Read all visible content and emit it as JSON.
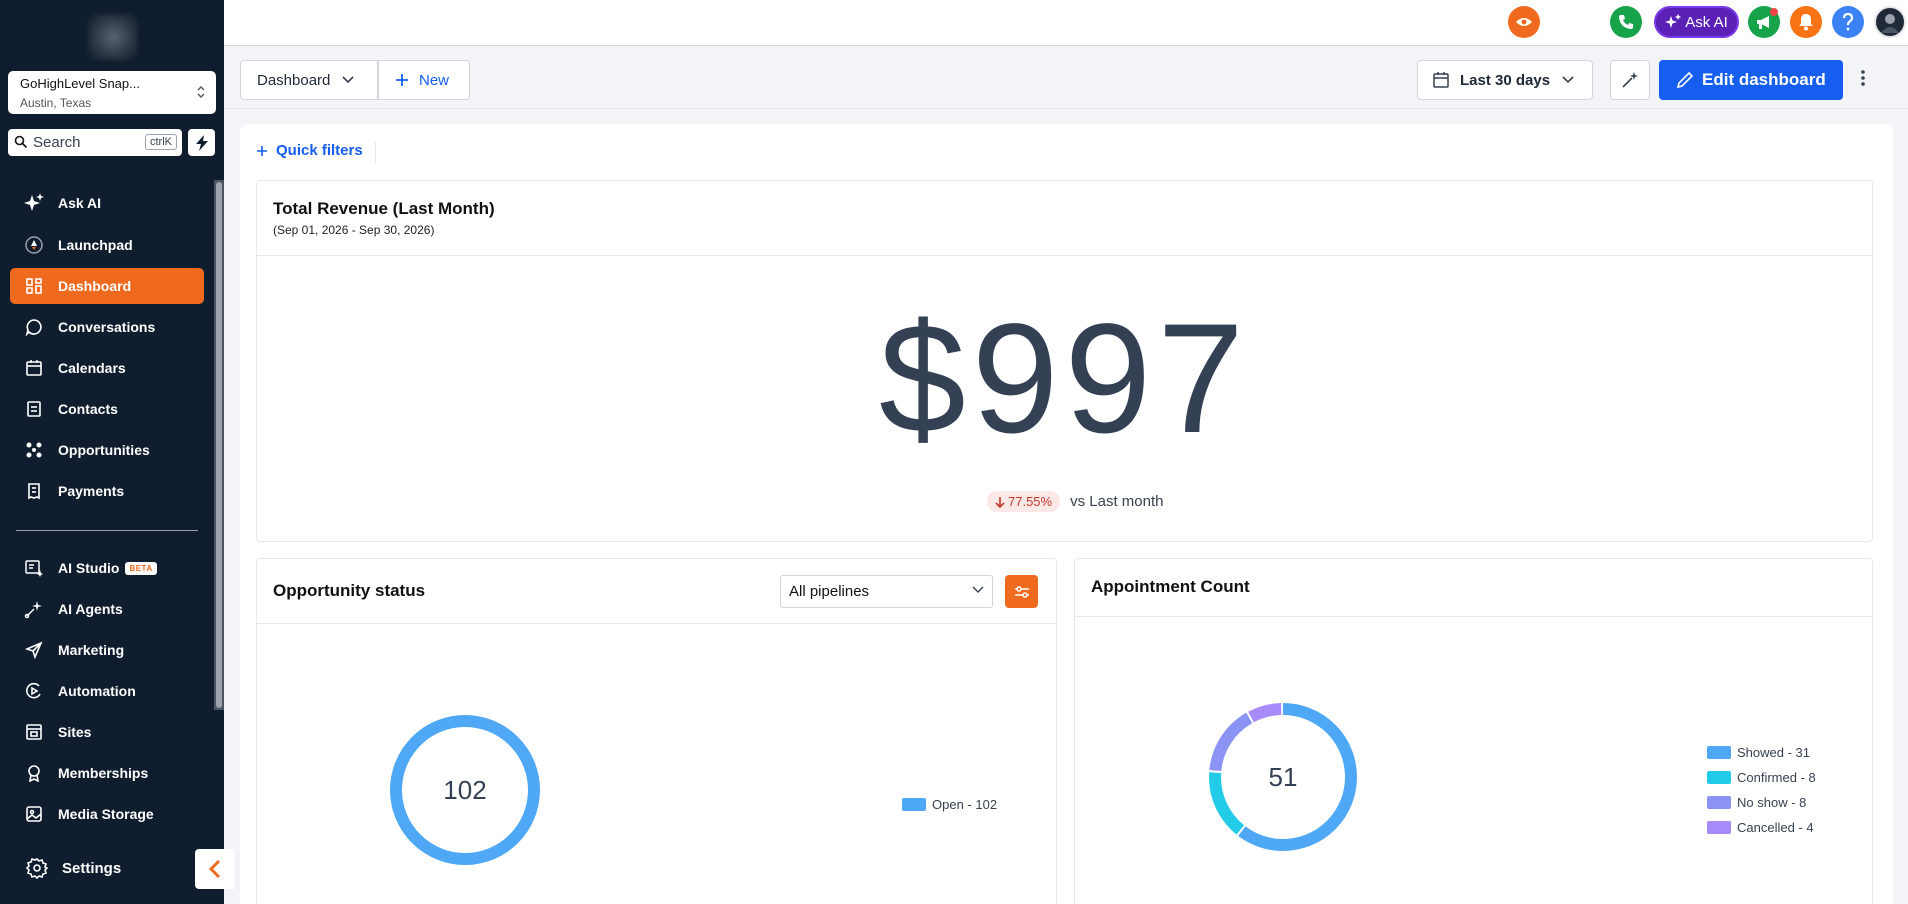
{
  "sidebar": {
    "account": {
      "name": "GoHighLevel Snap...",
      "location": "Austin, Texas"
    },
    "search": {
      "label": "Search",
      "shortcut": "ctrlK"
    },
    "items": [
      {
        "label": "Ask AI",
        "icon": "sparkles-icon"
      },
      {
        "label": "Launchpad",
        "icon": "rocket-icon"
      },
      {
        "label": "Dashboard",
        "icon": "grid-icon",
        "active": true
      },
      {
        "label": "Conversations",
        "icon": "chat-icon"
      },
      {
        "label": "Calendars",
        "icon": "calendar-icon"
      },
      {
        "label": "Contacts",
        "icon": "contacts-icon"
      },
      {
        "label": "Opportunities",
        "icon": "opportunities-icon"
      },
      {
        "label": "Payments",
        "icon": "receipt-icon"
      }
    ],
    "items2": [
      {
        "label": "AI Studio",
        "icon": "ai-studio-icon",
        "badge": "BETA"
      },
      {
        "label": "AI Agents",
        "icon": "ai-agents-icon"
      },
      {
        "label": "Marketing",
        "icon": "send-icon"
      },
      {
        "label": "Automation",
        "icon": "automation-icon"
      },
      {
        "label": "Sites",
        "icon": "sites-icon"
      },
      {
        "label": "Memberships",
        "icon": "award-icon"
      },
      {
        "label": "Media Storage",
        "icon": "image-icon"
      }
    ],
    "settings": "Settings"
  },
  "topbar": {
    "ask_ai": "Ask AI"
  },
  "toolbar": {
    "dashboard": "Dashboard",
    "new": "New",
    "date_range": "Last 30 days",
    "edit": "Edit dashboard"
  },
  "quick_filters": "Quick filters",
  "revenue": {
    "title": "Total Revenue (Last Month)",
    "subtitle": "(Sep 01, 2026 - Sep 30, 2026)",
    "value": "$997",
    "change": "77.55%",
    "comparison": "vs Last month"
  },
  "opportunity": {
    "title": "Opportunity status",
    "pipeline": "All pipelines",
    "total": "102"
  },
  "appointments": {
    "title": "Appointment Count",
    "total": "51"
  },
  "chart_data": [
    {
      "type": "pie",
      "title": "Opportunity status",
      "categories": [
        "Open"
      ],
      "values": [
        102
      ],
      "legend": [
        "Open - 102"
      ],
      "colors": [
        "#4ea8f5"
      ],
      "center_label": "102"
    },
    {
      "type": "pie",
      "title": "Appointment Count",
      "categories": [
        "Showed",
        "Confirmed",
        "No show",
        "Cancelled"
      ],
      "values": [
        31,
        8,
        8,
        4
      ],
      "legend": [
        "Showed - 31",
        "Confirmed - 8",
        "No show - 8",
        "Cancelled - 4"
      ],
      "colors": [
        "#4ea8f5",
        "#22cce8",
        "#8b93f5",
        "#a78bfa"
      ],
      "center_label": "51"
    }
  ]
}
